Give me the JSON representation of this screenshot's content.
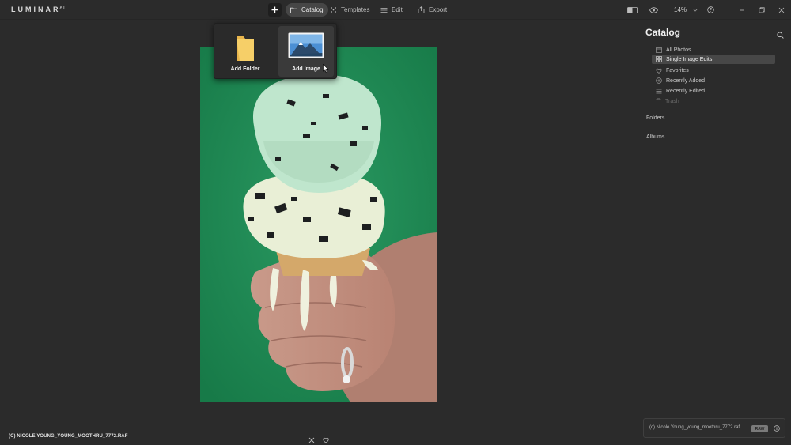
{
  "app": {
    "logo": "LUMINAR",
    "logo_sup": "AI"
  },
  "toolbar": {
    "tabs": [
      {
        "label": "Catalog",
        "icon": "folder-icon",
        "active": true
      },
      {
        "label": "Templates",
        "icon": "templates-icon",
        "active": false
      },
      {
        "label": "Edit",
        "icon": "sliders-icon",
        "active": false
      },
      {
        "label": "Export",
        "icon": "export-icon",
        "active": false
      }
    ],
    "zoom": "14%"
  },
  "add_menu": {
    "items": [
      {
        "label": "Add Folder",
        "icon": "folder-yellow-icon"
      },
      {
        "label": "Add Image",
        "icon": "image-mountain-icon"
      }
    ]
  },
  "photo": {
    "caption": "(C) NICOLE YOUNG_YOUNG_MOOTHRU_7772.RAF"
  },
  "sidebar": {
    "title": "Catalog",
    "items": [
      {
        "label": "All Photos",
        "icon": "photos-icon",
        "active": false,
        "dim": false
      },
      {
        "label": "Single Image Edits",
        "icon": "grid-icon",
        "active": true,
        "dim": false
      },
      {
        "label": "Favorites",
        "icon": "heart-icon",
        "active": false,
        "dim": false
      },
      {
        "label": "Recently Added",
        "icon": "plus-circle-icon",
        "active": false,
        "dim": false
      },
      {
        "label": "Recently Edited",
        "icon": "sliders-icon",
        "active": false,
        "dim": false
      },
      {
        "label": "Trash",
        "icon": "trash-icon",
        "active": false,
        "dim": true
      }
    ],
    "sections": [
      {
        "label": "Folders"
      },
      {
        "label": "Albums"
      }
    ],
    "info": {
      "filename": "(c) Nicole Young_young_moothru_7772.raf",
      "badge": "RAW"
    }
  },
  "colors": {
    "background": "#2b2b2b",
    "active_tab": "#464646",
    "sidebar_active": "#474747",
    "photo_bg": "#1f8a55",
    "plus_accent": "#ffffff"
  }
}
